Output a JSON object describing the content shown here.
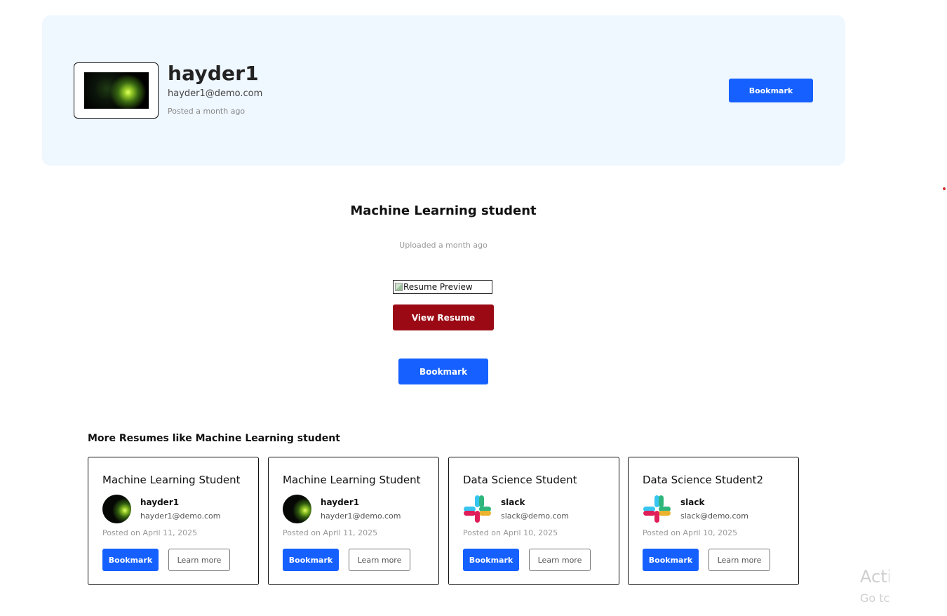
{
  "profile": {
    "name": "hayder1",
    "email": "hayder1@demo.com",
    "posted": "Posted a month ago",
    "bookmark_label": "Bookmark"
  },
  "resume": {
    "title": "Machine Learning student",
    "uploaded": "Uploaded a month ago",
    "preview_alt": "Resume Preview",
    "view_label": "View Resume",
    "bookmark_label": "Bookmark"
  },
  "more": {
    "heading": "More Resumes like Machine Learning student",
    "cards": [
      {
        "title": "Machine Learning Student",
        "name": "hayder1",
        "email": "hayder1@demo.com",
        "date": "Posted on April 11, 2025",
        "avatar": "dark-avatar",
        "bookmark_label": "Bookmark",
        "learn_label": "Learn more"
      },
      {
        "title": "Machine Learning Student",
        "name": "hayder1",
        "email": "hayder1@demo.com",
        "date": "Posted on April 11, 2025",
        "avatar": "dark-avatar",
        "bookmark_label": "Bookmark",
        "learn_label": "Learn more"
      },
      {
        "title": "Data Science Student",
        "name": "slack",
        "email": "slack@demo.com",
        "date": "Posted on April 10, 2025",
        "avatar": "slack-logo",
        "bookmark_label": "Bookmark",
        "learn_label": "Learn more"
      },
      {
        "title": "Data Science Student2",
        "name": "slack",
        "email": "slack@demo.com",
        "date": "Posted on April 10, 2025",
        "avatar": "slack-logo",
        "bookmark_label": "Bookmark",
        "learn_label": "Learn more"
      }
    ]
  },
  "watermark": {
    "line1": "Acti",
    "line2": "Go tc"
  },
  "colors": {
    "primary": "#1560ff",
    "danger": "#9b0a14",
    "header_bg": "#eff7ff"
  }
}
